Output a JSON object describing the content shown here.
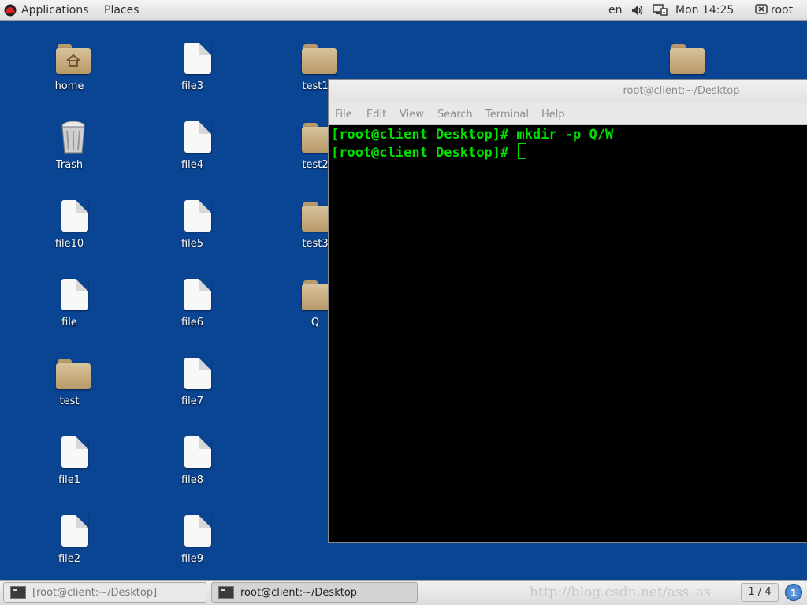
{
  "topbar": {
    "applications": "Applications",
    "places": "Places",
    "language": "en",
    "clock": "Mon 14:25",
    "user": "root"
  },
  "desktop_icons": [
    {
      "label": "home",
      "type": "home-folder"
    },
    {
      "label": "Trash",
      "type": "trash"
    },
    {
      "label": "file10",
      "type": "file"
    },
    {
      "label": "file",
      "type": "file"
    },
    {
      "label": "test",
      "type": "folder"
    },
    {
      "label": "file1",
      "type": "file"
    },
    {
      "label": "file2",
      "type": "file"
    },
    {
      "label": "file3",
      "type": "file"
    },
    {
      "label": "file4",
      "type": "file"
    },
    {
      "label": "file5",
      "type": "file"
    },
    {
      "label": "file6",
      "type": "file"
    },
    {
      "label": "file7",
      "type": "file"
    },
    {
      "label": "file8",
      "type": "file"
    },
    {
      "label": "file9",
      "type": "file"
    },
    {
      "label": "test1",
      "type": "folder"
    },
    {
      "label": "test2",
      "type": "folder"
    },
    {
      "label": "test3",
      "type": "folder"
    },
    {
      "label": "Q",
      "type": "folder"
    },
    {
      "label": "",
      "type": "folder"
    }
  ],
  "terminal": {
    "title": "root@client:~/Desktop",
    "menu": [
      "File",
      "Edit",
      "View",
      "Search",
      "Terminal",
      "Help"
    ],
    "lines": [
      "[root@client Desktop]# mkdir -p Q/W",
      "[root@client Desktop]# "
    ],
    "text_color": "#00e000",
    "background": "#000000"
  },
  "taskbar": {
    "tasks": [
      {
        "label": "[root@client:~/Desktop]",
        "active": false
      },
      {
        "label": "root@client:~/Desktop",
        "active": true
      }
    ],
    "watermark": "http://blog.csdn.net/ass_as",
    "workspace": "1 / 4",
    "notifications": "1"
  },
  "colors": {
    "desktop_background": "#0a4594",
    "terminal_text": "#00e000"
  }
}
